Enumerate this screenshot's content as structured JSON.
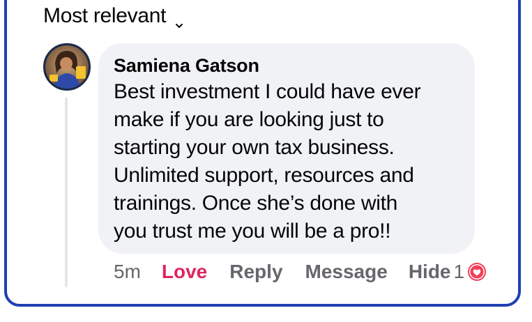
{
  "sort": {
    "label": "Most relevant",
    "icon": "chevron-down-icon"
  },
  "comment": {
    "author": "Samiena Gatson",
    "text": "Best investment I could have ever\nmake if you are looking just to\nstarting your own tax business.\nUnlimited support, resources  and\ntrainings. Once she’s done with\nyou trust me you will be a pro!!",
    "avatar_icon": "profile-photo",
    "actions": {
      "time": "5m",
      "love": "Love",
      "reply": "Reply",
      "message": "Message",
      "hide": "Hide"
    },
    "reaction_count": "1",
    "reaction_icon": "love-reaction-icon"
  },
  "colors": {
    "border": "#1f3fb2",
    "bubble": "#f0f2f5",
    "love": "#e0245e",
    "muted": "#65676b"
  }
}
